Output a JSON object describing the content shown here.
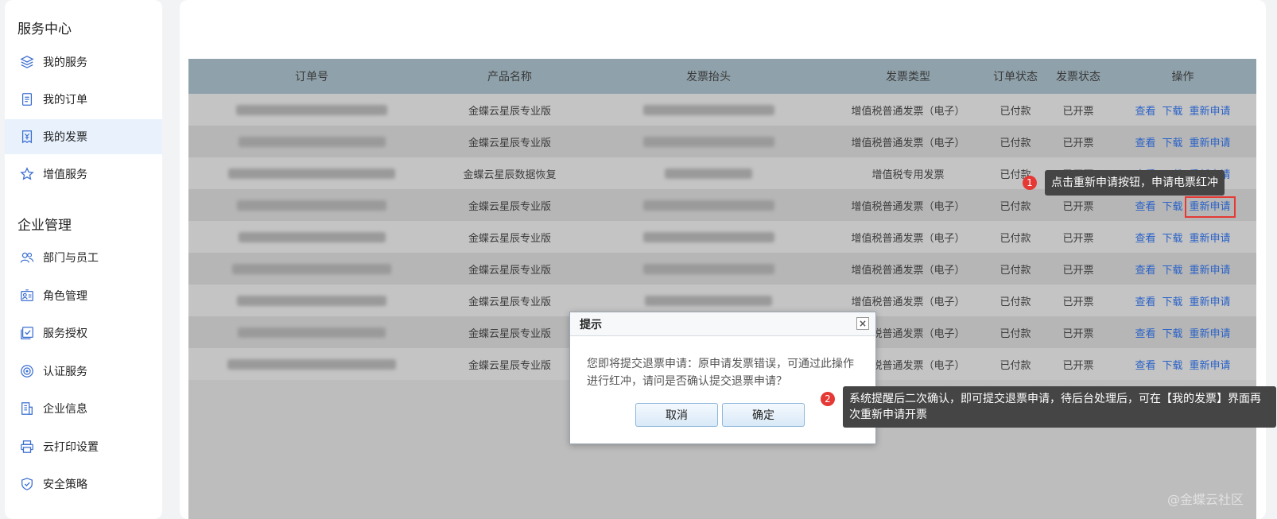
{
  "sidebar": {
    "groups": [
      "服务中心",
      "企业管理"
    ],
    "items": [
      {
        "label": "我的服务",
        "icon": "layers-icon"
      },
      {
        "label": "我的订单",
        "icon": "order-list-icon"
      },
      {
        "label": "我的发票",
        "icon": "invoice-icon"
      },
      {
        "label": "增值服务",
        "icon": "star-icon"
      },
      {
        "label": "部门与员工",
        "icon": "people-icon"
      },
      {
        "label": "角色管理",
        "icon": "role-card-icon"
      },
      {
        "label": "服务授权",
        "icon": "authorize-check-icon"
      },
      {
        "label": "认证服务",
        "icon": "target-icon"
      },
      {
        "label": "企业信息",
        "icon": "building-doc-icon"
      },
      {
        "label": "云打印设置",
        "icon": "printer-icon"
      },
      {
        "label": "安全策略",
        "icon": "shield-icon"
      }
    ]
  },
  "table": {
    "headers": [
      "订单号",
      "产品名称",
      "发票抬头",
      "发票类型",
      "订单状态",
      "发票状态",
      "操作"
    ],
    "actions": {
      "view": "查看",
      "download": "下载",
      "reapply": "重新申请"
    },
    "rows": [
      {
        "product": "金蝶云星辰专业版",
        "type": "增值税普通发票（电子）",
        "order_status": "已付款",
        "invoice_status": "已开票"
      },
      {
        "product": "金蝶云星辰专业版",
        "type": "增值税普通发票（电子）",
        "order_status": "已付款",
        "invoice_status": "已开票"
      },
      {
        "product": "金蝶云星辰数据恢复",
        "type": "增值税专用发票",
        "order_status": "已付款",
        "invoice_status": "已开票"
      },
      {
        "product": "金蝶云星辰专业版",
        "type": "增值税普通发票（电子）",
        "order_status": "已付款",
        "invoice_status": "已开票"
      },
      {
        "product": "金蝶云星辰专业版",
        "type": "增值税普通发票（电子）",
        "order_status": "已付款",
        "invoice_status": "已开票"
      },
      {
        "product": "金蝶云星辰专业版",
        "type": "增值税普通发票（电子）",
        "order_status": "已付款",
        "invoice_status": "已开票"
      },
      {
        "product": "金蝶云星辰专业版",
        "type": "增值税普通发票（电子）",
        "order_status": "已付款",
        "invoice_status": "已开票"
      },
      {
        "product": "金蝶云星辰专业版",
        "type": "增值税普通发票（电子）",
        "order_status": "已付款",
        "invoice_status": "已开票"
      },
      {
        "product": "金蝶云星辰专业版",
        "type": "增值税普通发票（电子）",
        "order_status": "已付款",
        "invoice_status": "已开票"
      }
    ]
  },
  "dialog": {
    "title": "提示",
    "close": "×",
    "message": "您即将提交退票申请：原申请发票错误，可通过此操作进行红冲，请问是否确认提交退票申请？",
    "cancel": "取消",
    "confirm": "确定"
  },
  "annotations": [
    {
      "num": "1",
      "text": "点击重新申请按钮，申请电票红冲"
    },
    {
      "num": "2",
      "text": "系统提醒后二次确认，即可提交退票申请，待后台处理后，可在【我的发票】界面再次重新申请开票"
    }
  ],
  "watermark": "@金蝶云社区"
}
